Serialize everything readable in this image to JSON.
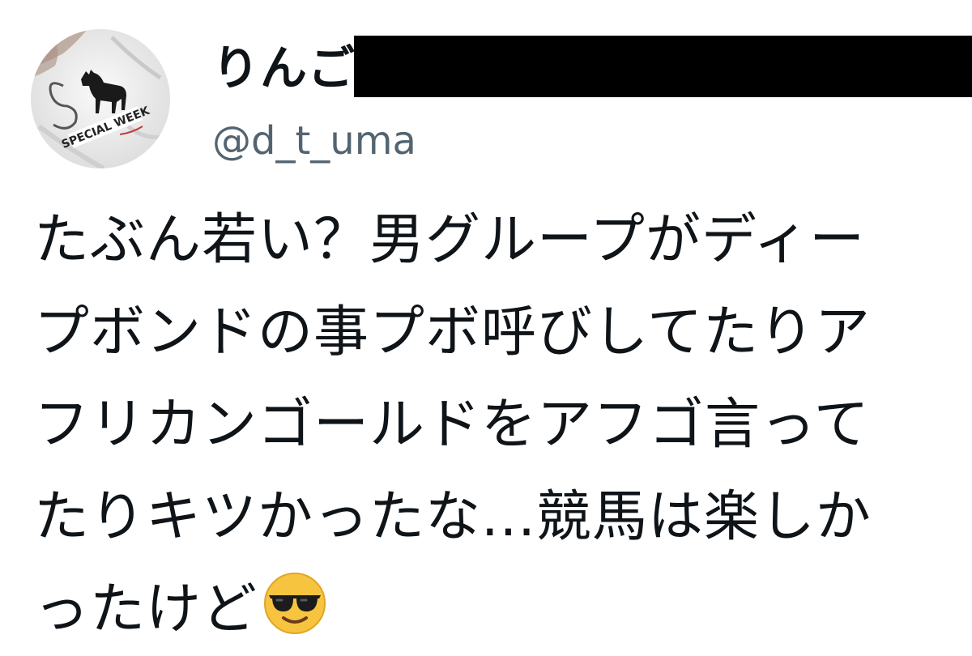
{
  "tweet": {
    "display_name": "りんご",
    "handle": "@d_t_uma",
    "avatar_icon": "horse-tshirt-avatar",
    "text_lines": [
      "たぶん若い？男グループがディー",
      "プボンドの事プボ呼びしてたりア",
      "フリカンゴールドをアフゴ言って",
      "たりキツかったな...競馬は楽しか",
      "ったけど"
    ],
    "emoji": "smiling-face-with-sunglasses"
  },
  "colors": {
    "text": "#0f1419",
    "secondary_text": "#536471",
    "redaction": "#000000",
    "background": "#ffffff"
  }
}
